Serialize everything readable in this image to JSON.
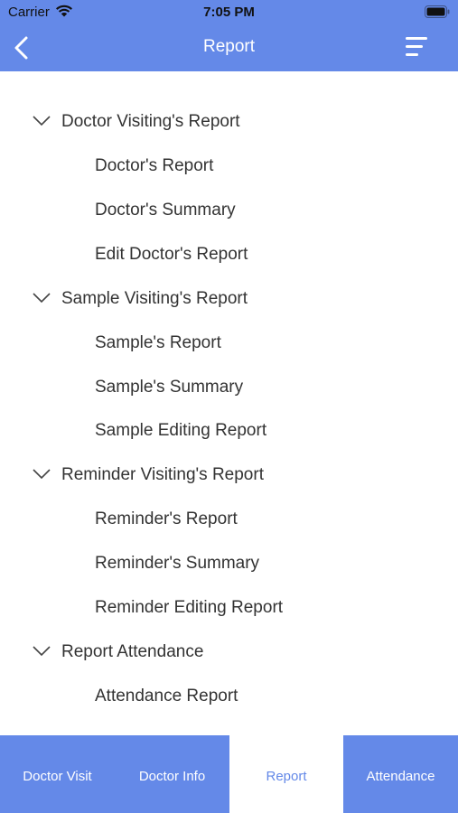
{
  "status_bar": {
    "carrier": "Carrier",
    "time": "7:05 PM"
  },
  "nav": {
    "title": "Report",
    "back_icon": "chevron-left-icon",
    "menu_icon": "hamburger-menu-icon"
  },
  "report_groups": [
    {
      "label": "Doctor Visiting's Report",
      "expanded": true,
      "items": [
        "Doctor's Report",
        "Doctor's Summary",
        "Edit Doctor's Report"
      ]
    },
    {
      "label": "Sample Visiting's Report",
      "expanded": true,
      "items": [
        "Sample's Report",
        "Sample's Summary",
        "Sample Editing Report"
      ]
    },
    {
      "label": "Reminder Visiting's Report",
      "expanded": true,
      "items": [
        "Reminder's Report",
        "Reminder's Summary",
        "Reminder Editing Report"
      ]
    },
    {
      "label": "Report Attendance",
      "expanded": true,
      "items": [
        "Attendance Report"
      ]
    }
  ],
  "tabs": [
    {
      "label": "Doctor Visit",
      "active": false
    },
    {
      "label": "Doctor Info",
      "active": false
    },
    {
      "label": "Report",
      "active": true
    },
    {
      "label": "Attendance",
      "active": false
    }
  ],
  "colors": {
    "primary": "#6489e8",
    "text": "#333333",
    "background": "#ffffff"
  }
}
